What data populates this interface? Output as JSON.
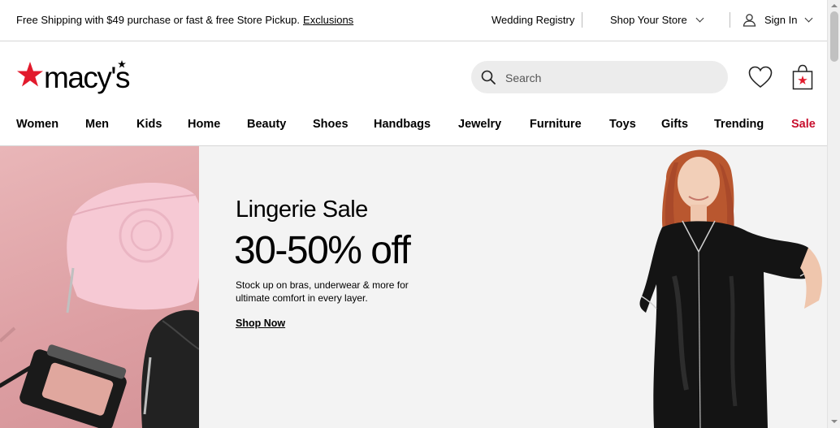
{
  "topbar": {
    "shipping_text": "Free Shipping with $49 purchase or fast & free Store Pickup.",
    "exclusions_link": "Exclusions",
    "wedding_registry": "Wedding Registry",
    "shop_your_store": "Shop Your Store",
    "sign_in": "Sign In"
  },
  "header": {
    "logo_text": "macy's",
    "search_placeholder": "Search",
    "brand_color": "#e21a2c"
  },
  "nav": {
    "items": [
      "Women",
      "Men",
      "Kids",
      "Home",
      "Beauty",
      "Shoes",
      "Handbags",
      "Jewelry",
      "Furniture",
      "Toys",
      "Gifts",
      "Trending",
      "Sale"
    ],
    "sale_color": "#c8102e"
  },
  "hero": {
    "subtitle": "Lingerie Sale",
    "headline": "30-50% off",
    "description": "Stock up on bras, underwear & more for ultimate comfort in every layer.",
    "cta": "Shop Now"
  },
  "icons": [
    "user-icon",
    "search-icon",
    "heart-icon",
    "shopping-bag-icon",
    "chevron-down-icon"
  ]
}
